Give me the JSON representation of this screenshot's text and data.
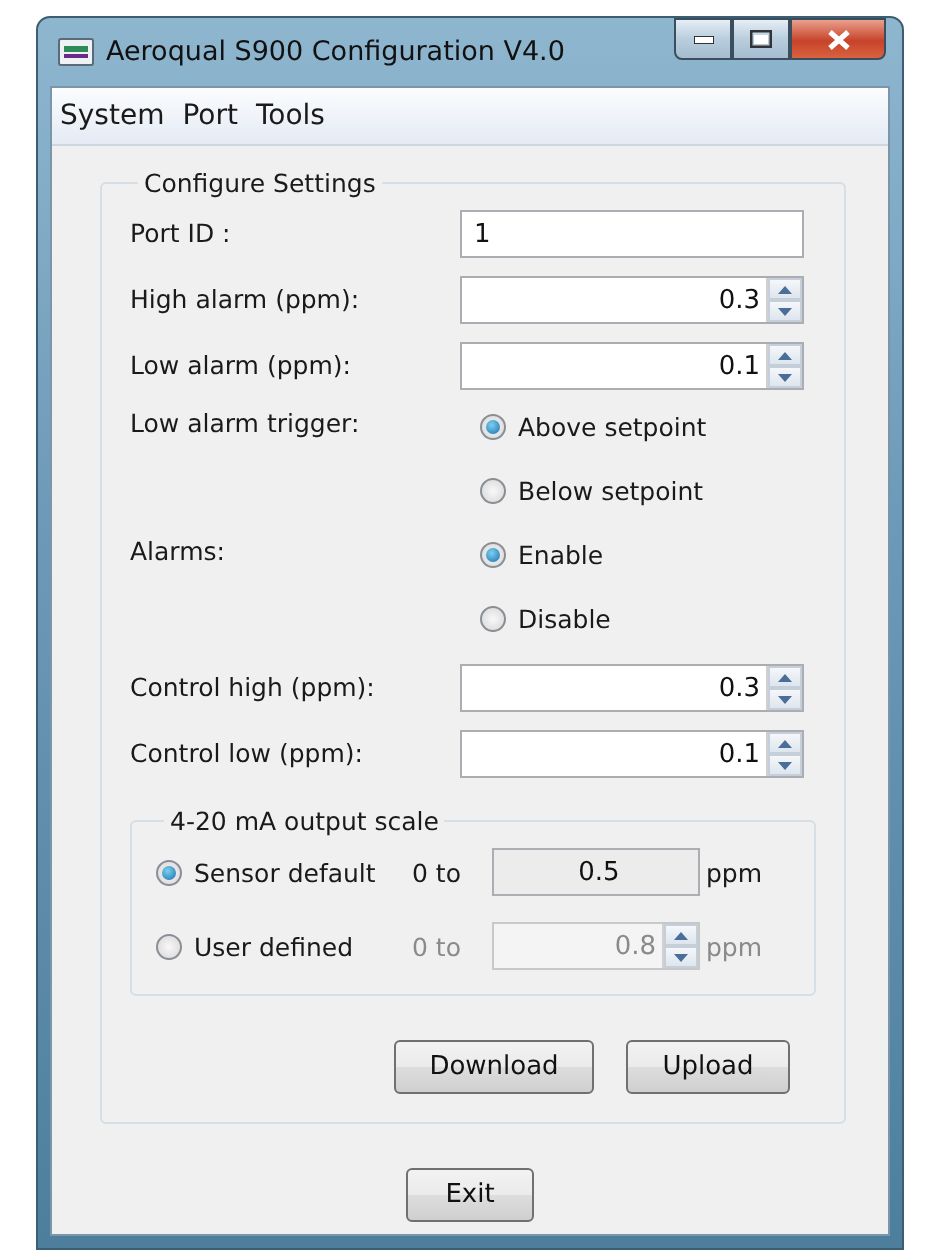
{
  "window": {
    "title": "Aeroqual S900 Configuration V4.0"
  },
  "menu": [
    "System",
    "Port",
    "Tools"
  ],
  "settings": {
    "title": "Configure Settings",
    "rows": [
      {
        "kind": "text",
        "label": "Port ID :",
        "value": "1"
      },
      {
        "kind": "spin",
        "label": "High alarm (ppm):",
        "value": "0.3"
      },
      {
        "kind": "spin",
        "label": "Low alarm (ppm):",
        "value": "0.1"
      },
      {
        "kind": "radio",
        "label": "Low alarm trigger:",
        "options": [
          {
            "label": "Above setpoint",
            "selected": true
          },
          {
            "label": "Below setpoint",
            "selected": false
          }
        ]
      },
      {
        "kind": "radio",
        "label": "Alarms:",
        "options": [
          {
            "label": "Enable",
            "selected": true
          },
          {
            "label": "Disable",
            "selected": false
          }
        ]
      },
      {
        "kind": "spin",
        "label": "Control high (ppm):",
        "value": "0.3"
      },
      {
        "kind": "spin",
        "label": "Control low (ppm):",
        "value": "0.1"
      }
    ]
  },
  "output_scale": {
    "title": "4-20 mA output scale",
    "options": [
      {
        "kind": "text",
        "label": "Sensor default",
        "selected": true,
        "disabled": false,
        "range": "0 to",
        "value": "0.5",
        "unit": "ppm"
      },
      {
        "kind": "spin",
        "label": "User defined",
        "selected": false,
        "disabled": true,
        "range": "0 to",
        "value": "0.8",
        "unit": "ppm"
      }
    ]
  },
  "buttons": [
    "Download",
    "Upload"
  ],
  "exit_button": "Exit"
}
